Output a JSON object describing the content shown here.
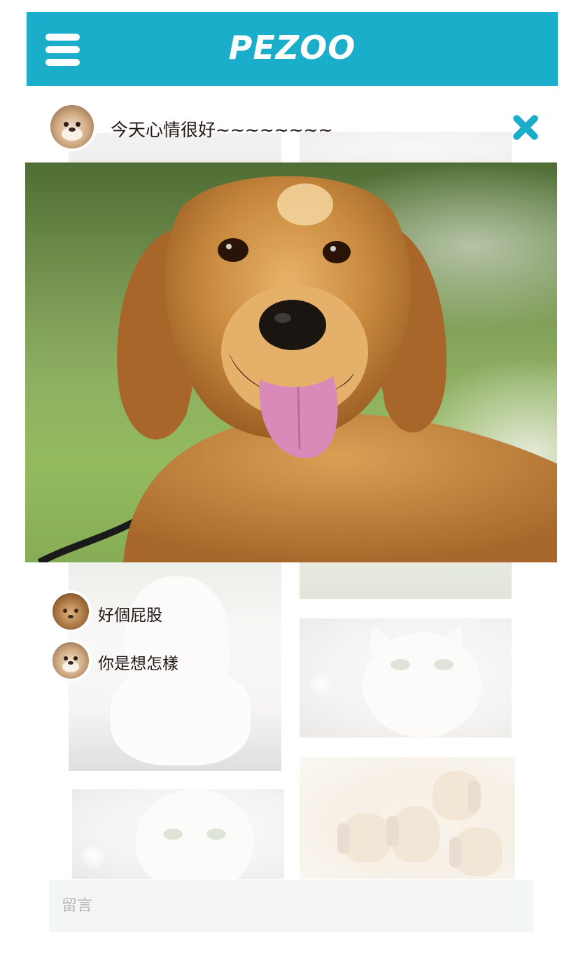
{
  "app": {
    "brand": "PEZOO",
    "accent_color": "#1aaecb",
    "menu_icon": "hamburger-icon"
  },
  "post": {
    "caption": "今天心情很好~~~~~~~~",
    "close_icon": "close-icon",
    "author_avatar": "french-bulldog-avatar",
    "photo": "golden-retriever-photo"
  },
  "comments": [
    {
      "avatar": "cat-avatar",
      "text": "好個屁股"
    },
    {
      "avatar": "french-bulldog-avatar",
      "text": "你是想怎樣"
    }
  ],
  "comment_box": {
    "placeholder": "留言"
  },
  "background_gallery": [
    "gray-tile",
    "cat-tile",
    "shih-tzu-tile",
    "grass-tile",
    "persian-cat-tile",
    "persian-cat-tile",
    "dachshund-puppies-tile"
  ]
}
